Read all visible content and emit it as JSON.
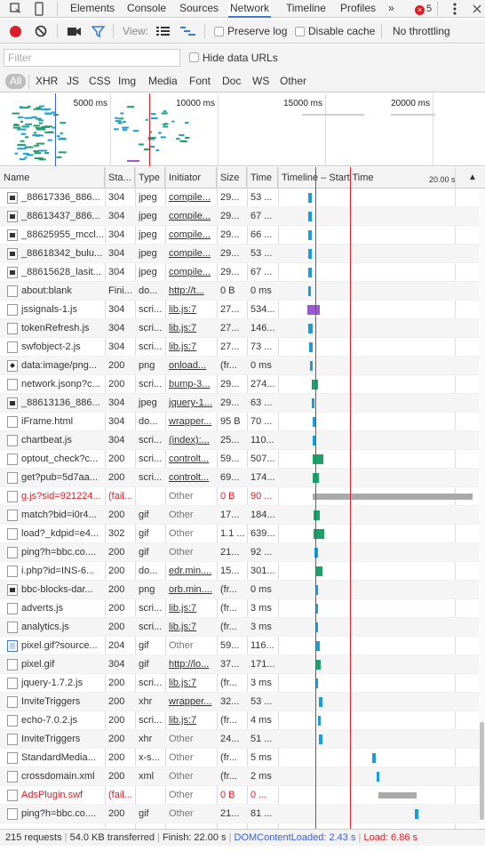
{
  "tabs": [
    "Elements",
    "Console",
    "Sources",
    "Network",
    "Timeline",
    "Profiles"
  ],
  "overflow_glyph": "»",
  "error_count": "5",
  "toolbar": {
    "view_label": "View:",
    "preserve_log": "Preserve log",
    "disable_cache": "Disable cache",
    "throttling": "No throttling"
  },
  "filter": {
    "placeholder": "Filter",
    "hide_data_urls": "Hide data URLs",
    "types": [
      "All",
      "XHR",
      "JS",
      "CSS",
      "Img",
      "Media",
      "Font",
      "Doc",
      "WS",
      "Other"
    ]
  },
  "overview_ticks": [
    "5000 ms",
    "10000 ms",
    "15000 ms",
    "20000 ms"
  ],
  "columns": {
    "name": "Name",
    "status": "Sta...",
    "type": "Type",
    "initiator": "Initiator",
    "size": "Size",
    "time": "Time",
    "timeline": "Timeline – Start Time",
    "timeline_tick": "20.00 s"
  },
  "rows": [
    {
      "name": "_88617336_886...",
      "status": "304",
      "type": "jpeg",
      "initiator": "compile...",
      "size": "29...",
      "time": "53 ...",
      "icon": "img",
      "wf_start": 0.5,
      "wf_len": 0.15,
      "color": "#1a9ed8"
    },
    {
      "name": "_88613437_886...",
      "status": "304",
      "type": "jpeg",
      "initiator": "compile...",
      "size": "29...",
      "time": "67 ...",
      "icon": "img",
      "wf_start": 0.5,
      "wf_len": 0.15,
      "color": "#1a9ed8"
    },
    {
      "name": "_88625955_mccl...",
      "status": "304",
      "type": "jpeg",
      "initiator": "compile...",
      "size": "29...",
      "time": "66 ...",
      "icon": "img-dark",
      "wf_start": 0.5,
      "wf_len": 0.15,
      "color": "#1a9ed8"
    },
    {
      "name": "_88618342_bulu...",
      "status": "304",
      "type": "jpeg",
      "initiator": "compile...",
      "size": "29...",
      "time": "53 ...",
      "icon": "img",
      "wf_start": 0.5,
      "wf_len": 0.15,
      "color": "#1a9ed8"
    },
    {
      "name": "_88615628_lasit...",
      "status": "304",
      "type": "jpeg",
      "initiator": "compile...",
      "size": "29...",
      "time": "67 ...",
      "icon": "img",
      "wf_start": 0.5,
      "wf_len": 0.15,
      "color": "#1a9ed8"
    },
    {
      "name": "about:blank",
      "status": "Fini...",
      "type": "do...",
      "initiator": "http://t...",
      "size": "0 B",
      "time": "0 ms",
      "icon": "file",
      "wf_start": 0.5,
      "wf_len": 0.1,
      "color": "#1a9ed8"
    },
    {
      "name": "jssignals-1.js",
      "status": "304",
      "type": "scri...",
      "initiator": "lib.js:7",
      "size": "27...",
      "time": "534...",
      "icon": "file",
      "wf_start": 0.45,
      "wf_len": 0.6,
      "color": "#9b59d0"
    },
    {
      "name": "tokenRefresh.js",
      "status": "304",
      "type": "scri...",
      "initiator": "lib.js:7",
      "size": "27...",
      "time": "146...",
      "icon": "file",
      "wf_start": 0.5,
      "wf_len": 0.2,
      "color": "#1a9ed8"
    },
    {
      "name": "swfobject-2.js",
      "status": "304",
      "type": "scri...",
      "initiator": "lib.js:7",
      "size": "27...",
      "time": "73 ...",
      "icon": "file",
      "wf_start": 0.55,
      "wf_len": 0.15,
      "color": "#1a9ed8"
    },
    {
      "name": "data:image/png...",
      "status": "200",
      "type": "png",
      "initiator": "onload...",
      "size": "(fr...",
      "time": "0 ms",
      "icon": "dot",
      "wf_start": 0.6,
      "wf_len": 0.05,
      "color": "#1a9ed8"
    },
    {
      "name": "network.jsonp?c...",
      "status": "200",
      "type": "scri...",
      "initiator": "bump-3...",
      "size": "29...",
      "time": "274...",
      "icon": "file",
      "wf_start": 0.65,
      "wf_len": 0.3,
      "color": "#1fa06a"
    },
    {
      "name": "_88613136_886...",
      "status": "304",
      "type": "jpeg",
      "initiator": "jquery-1...",
      "size": "29...",
      "time": "63 ...",
      "icon": "img-dark",
      "wf_start": 0.65,
      "wf_len": 0.15,
      "color": "#1a9ed8"
    },
    {
      "name": "iFrame.html",
      "status": "304",
      "type": "do...",
      "initiator": "wrapper...",
      "size": "95 B",
      "time": "70 ...",
      "icon": "file",
      "wf_start": 0.7,
      "wf_len": 0.15,
      "color": "#1a9ed8"
    },
    {
      "name": "chartbeat.js",
      "status": "304",
      "type": "scri...",
      "initiator": "(index):...",
      "size": "25...",
      "time": "110...",
      "icon": "file",
      "wf_start": 0.7,
      "wf_len": 0.15,
      "color": "#1a9ed8"
    },
    {
      "name": "optout_check?c...",
      "status": "200",
      "type": "scri...",
      "initiator": "controlt...",
      "size": "59...",
      "time": "507...",
      "icon": "file",
      "wf_start": 0.7,
      "wf_len": 0.5,
      "color": "#1fa06a"
    },
    {
      "name": "get?pub=5d7aa...",
      "status": "200",
      "type": "scri...",
      "initiator": "controlt...",
      "size": "69...",
      "time": "174...",
      "icon": "file",
      "wf_start": 0.7,
      "wf_len": 0.3,
      "color": "#1fa06a"
    },
    {
      "name": "g.js?sid=921224...",
      "status": "(fail...",
      "type": "",
      "initiator": "Other",
      "size": "0 B",
      "time": "90 ...",
      "icon": "file",
      "failed": true,
      "wf_start": 0.7,
      "wf_len": 12,
      "color": "#aaaaaa"
    },
    {
      "name": "match?bid=i0r4...",
      "status": "200",
      "type": "gif",
      "initiator": "Other",
      "size": "17...",
      "time": "184...",
      "icon": "file",
      "wf_start": 0.75,
      "wf_len": 0.3,
      "color": "#1fa06a"
    },
    {
      "name": "load?_kdpid=e4...",
      "status": "302",
      "type": "gif",
      "initiator": "Other",
      "size": "1.1 ...",
      "time": "639...",
      "icon": "file",
      "wf_start": 0.75,
      "wf_len": 0.5,
      "color": "#1fa06a"
    },
    {
      "name": "ping?h=bbc.co....",
      "status": "200",
      "type": "gif",
      "initiator": "Other",
      "size": "21...",
      "time": "92 ...",
      "icon": "file",
      "wf_start": 0.8,
      "wf_len": 0.15,
      "color": "#1a9ed8"
    },
    {
      "name": "i.php?id=INS-6...",
      "status": "200",
      "type": "do...",
      "initiator": "edr.min....",
      "size": "15...",
      "time": "301...",
      "icon": "file",
      "wf_start": 0.85,
      "wf_len": 0.3,
      "color": "#1fa06a"
    },
    {
      "name": "bbc-blocks-dar...",
      "status": "200",
      "type": "png",
      "initiator": "orb.min....",
      "size": "(fr...",
      "time": "0 ms",
      "icon": "img-dark",
      "wf_start": 0.85,
      "wf_len": 0.05,
      "color": "#1a9ed8"
    },
    {
      "name": "adverts.js",
      "status": "200",
      "type": "scri...",
      "initiator": "lib.js:7",
      "size": "(fr...",
      "time": "3 ms",
      "icon": "file",
      "wf_start": 0.85,
      "wf_len": 0.1,
      "color": "#1a9ed8"
    },
    {
      "name": "analytics.js",
      "status": "200",
      "type": "scri...",
      "initiator": "lib.js:7",
      "size": "(fr...",
      "time": "3 ms",
      "icon": "file",
      "wf_start": 0.85,
      "wf_len": 0.1,
      "color": "#1a9ed8"
    },
    {
      "name": "pixel.gif?source...",
      "status": "204",
      "type": "gif",
      "initiator": "Other",
      "size": "59...",
      "time": "116...",
      "icon": "blue",
      "wf_start": 0.85,
      "wf_len": 0.2,
      "color": "#1a9ed8"
    },
    {
      "name": "pixel.gif",
      "status": "304",
      "type": "gif",
      "initiator": "http://lo...",
      "size": "37...",
      "time": "171...",
      "icon": "file",
      "wf_start": 0.85,
      "wf_len": 0.25,
      "color": "#1fa06a"
    },
    {
      "name": "jquery-1.7.2.js",
      "status": "200",
      "type": "scri...",
      "initiator": "lib.js:7",
      "size": "(fr...",
      "time": "3 ms",
      "icon": "file",
      "wf_start": 0.85,
      "wf_len": 0.1,
      "color": "#1a9ed8"
    },
    {
      "name": "InviteTriggers",
      "status": "200",
      "type": "xhr",
      "initiator": "wrapper...",
      "size": "32...",
      "time": "53 ...",
      "icon": "file",
      "wf_start": 1.0,
      "wf_len": 0.15,
      "color": "#1a9ed8"
    },
    {
      "name": "echo-7.0.2.js",
      "status": "200",
      "type": "scri...",
      "initiator": "lib.js:7",
      "size": "(fr...",
      "time": "4 ms",
      "icon": "file",
      "wf_start": 0.95,
      "wf_len": 0.15,
      "color": "#1a9ed8"
    },
    {
      "name": "InviteTriggers",
      "status": "200",
      "type": "xhr",
      "initiator": "Other",
      "size": "24...",
      "time": "51 ...",
      "icon": "file",
      "wf_start": 1.0,
      "wf_len": 0.15,
      "color": "#1a9ed8"
    },
    {
      "name": "StandardMedia...",
      "status": "200",
      "type": "x-s...",
      "initiator": "Other",
      "size": "(fr...",
      "time": "5 ms",
      "icon": "file",
      "wf_start": 3.5,
      "wf_len": 0.15,
      "color": "#1a9ed8"
    },
    {
      "name": "crossdomain.xml",
      "status": "200",
      "type": "xml",
      "initiator": "Other",
      "size": "(fr...",
      "time": "2 ms",
      "icon": "file",
      "wf_start": 3.7,
      "wf_len": 0.15,
      "color": "#1a9ed8"
    },
    {
      "name": "AdsPlugin.swf",
      "status": "(fail...",
      "type": "",
      "initiator": "Other",
      "size": "0 B",
      "time": "0 ...",
      "icon": "file",
      "failed": true,
      "wf_start": 3.8,
      "wf_len": 1.8,
      "color": "#aaaaaa"
    },
    {
      "name": "ping?h=bbc.co....",
      "status": "200",
      "type": "gif",
      "initiator": "Other",
      "size": "21...",
      "time": "81 ...",
      "icon": "file",
      "wf_start": 5.5,
      "wf_len": 0.15,
      "color": "#1a9ed8"
    }
  ],
  "status": {
    "requests": "215 requests",
    "transferred": "54.0 KB transferred",
    "finish": "Finish: 22.00 s",
    "dom": "DOMContentLoaded: 2.43 s",
    "load": "Load: 6.86 s"
  },
  "colors": {
    "active_tab": "#3879d9",
    "record": "#d9202a",
    "filter_active": "#3879d9",
    "dom_line": "#3b5fd9",
    "load_line": "#d9202a"
  }
}
